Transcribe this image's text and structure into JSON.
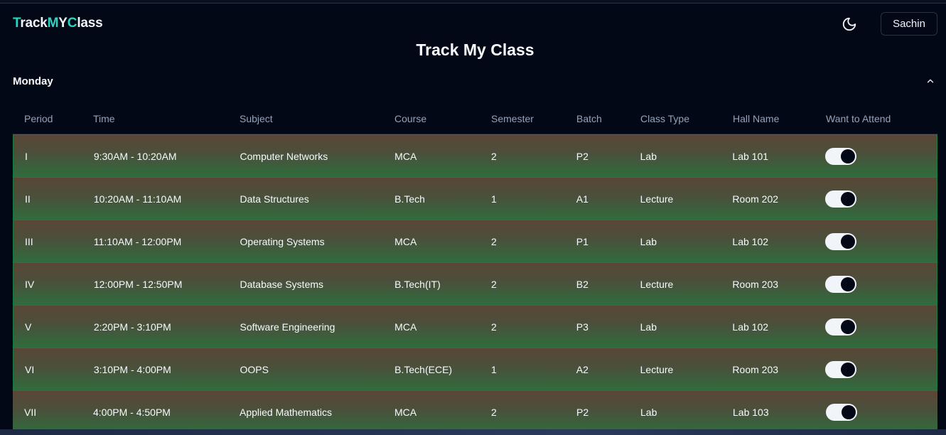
{
  "app": {
    "logo": {
      "p1": "T",
      "p2": "rack",
      "p3": "M",
      "p4": "Y",
      "p5": "C",
      "p6": "lass"
    },
    "user_label": "Sachin",
    "theme_icon": "moon-icon"
  },
  "page": {
    "title": "Track My Class"
  },
  "day": {
    "label": "Monday",
    "expanded": true,
    "chevron": "chevron-up-icon"
  },
  "table": {
    "columns": [
      "Period",
      "Time",
      "Subject",
      "Course",
      "Semester",
      "Batch",
      "Class Type",
      "Hall Name",
      "Want to Attend"
    ],
    "rows": [
      {
        "period": "I",
        "time": "9:30AM - 10:20AM",
        "subject": "Computer Networks",
        "course": "MCA",
        "semester": "2",
        "batch": "P2",
        "class_type": "Lab",
        "hall": "Lab 101",
        "attend": true
      },
      {
        "period": "II",
        "time": "10:20AM - 11:10AM",
        "subject": "Data Structures",
        "course": "B.Tech",
        "semester": "1",
        "batch": "A1",
        "class_type": "Lecture",
        "hall": "Room 202",
        "attend": true
      },
      {
        "period": "III",
        "time": "11:10AM - 12:00PM",
        "subject": "Operating Systems",
        "course": "MCA",
        "semester": "2",
        "batch": "P1",
        "class_type": "Lab",
        "hall": "Lab 102",
        "attend": true
      },
      {
        "period": "IV",
        "time": "12:00PM - 12:50PM",
        "subject": "Database Systems",
        "course": "B.Tech(IT)",
        "semester": "2",
        "batch": "B2",
        "class_type": "Lecture",
        "hall": "Room 203",
        "attend": true
      },
      {
        "period": "V",
        "time": "2:20PM - 3:10PM",
        "subject": "Software Engineering",
        "course": "MCA",
        "semester": "2",
        "batch": "P3",
        "class_type": "Lab",
        "hall": "Lab 102",
        "attend": true
      },
      {
        "period": "VI",
        "time": "3:10PM - 4:00PM",
        "subject": "OOPS",
        "course": "B.Tech(ECE)",
        "semester": "1",
        "batch": "A2",
        "class_type": "Lecture",
        "hall": "Room 203",
        "attend": true
      },
      {
        "period": "VII",
        "time": "4:00PM - 4:50PM",
        "subject": "Applied Mathematics",
        "course": "MCA",
        "semester": "2",
        "batch": "P2",
        "class_type": "Lab",
        "hall": "Lab 103",
        "attend": true
      }
    ]
  },
  "colors": {
    "background": "#030817",
    "logo_accent": "#2dd4bf",
    "row_border": "#15803d",
    "row_gradient_top": "#5a4636",
    "row_gradient_bottom": "#2f6c3d",
    "header_text": "#94a3b8"
  }
}
